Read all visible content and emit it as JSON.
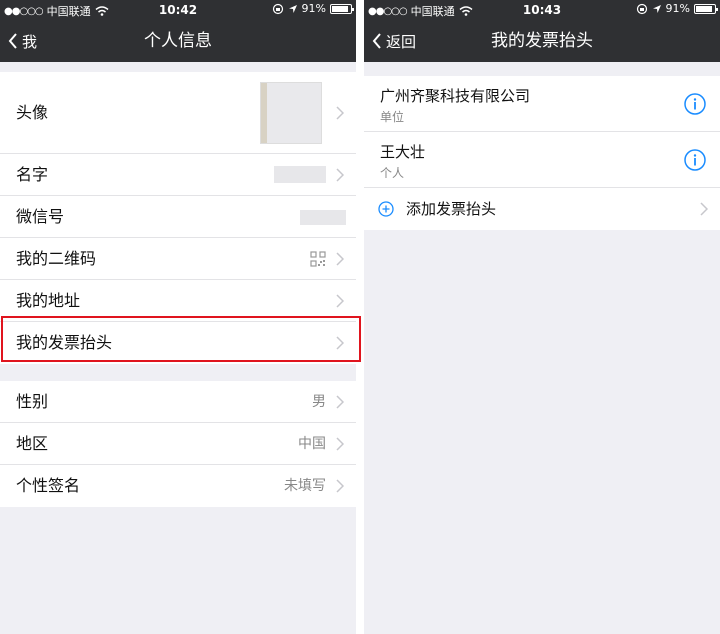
{
  "left": {
    "status": {
      "carrier": "中国联通",
      "time": "10:42",
      "battery": "91%",
      "battery_level": 0.91
    },
    "nav": {
      "back_label": "我",
      "title": "个人信息"
    },
    "group1": [
      {
        "label": "头像"
      },
      {
        "label": "名字"
      },
      {
        "label": "微信号"
      },
      {
        "label": "我的二维码"
      },
      {
        "label": "我的地址"
      },
      {
        "label": "我的发票抬头"
      }
    ],
    "group2": [
      {
        "label": "性别",
        "value": "男"
      },
      {
        "label": "地区",
        "value": "中国"
      },
      {
        "label": "个性签名",
        "value": "未填写"
      }
    ],
    "highlight_color": "#e0141e"
  },
  "right": {
    "status": {
      "carrier": "中国联通",
      "time": "10:43",
      "battery": "91%",
      "battery_level": 0.91
    },
    "nav": {
      "back_label": "返回",
      "title": "我的发票抬头"
    },
    "invoices": [
      {
        "name": "广州齐聚科技有限公司",
        "type": "单位"
      },
      {
        "name": "王大壮",
        "type": "个人"
      }
    ],
    "add_label": "添加发票抬头",
    "accent_color": "#1a8cff"
  },
  "icons": {
    "chevron": "chevron-right-icon",
    "info": "info-circle-icon",
    "add": "plus-circle-icon",
    "qr": "qr-code-icon",
    "back": "chevron-left-icon",
    "location": "location-arrow-icon",
    "rotation_lock": "rotation-lock-icon",
    "wifi": "wifi-icon"
  }
}
